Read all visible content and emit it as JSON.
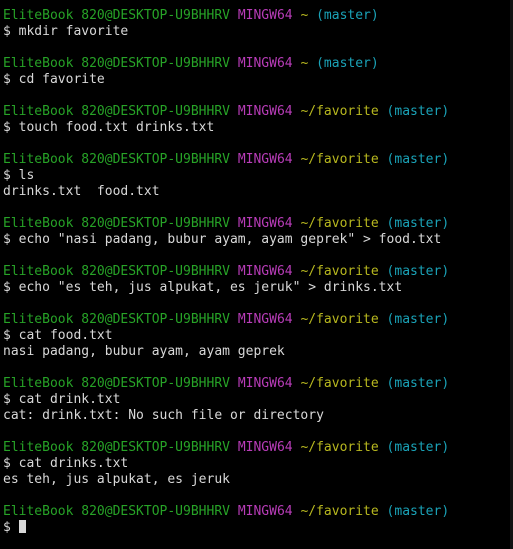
{
  "prompt": {
    "user_host": "EliteBook 820@DESKTOP-U9BHHRV",
    "system": "MINGW64",
    "dollar": "$ "
  },
  "blocks": [
    {
      "path": "~",
      "branch": "(master)",
      "command": "mkdir favorite",
      "output": []
    },
    {
      "path": "~",
      "branch": "(master)",
      "command": "cd favorite",
      "output": []
    },
    {
      "path": "~/favorite",
      "branch": "(master)",
      "command": "touch food.txt drinks.txt",
      "output": []
    },
    {
      "path": "~/favorite",
      "branch": "(master)",
      "command": "ls",
      "output": [
        "drinks.txt  food.txt"
      ]
    },
    {
      "path": "~/favorite",
      "branch": "(master)",
      "command": "echo \"nasi padang, bubur ayam, ayam geprek\" > food.txt",
      "output": []
    },
    {
      "path": "~/favorite",
      "branch": "(master)",
      "command": "echo \"es teh, jus alpukat, es jeruk\" > drinks.txt",
      "output": []
    },
    {
      "path": "~/favorite",
      "branch": "(master)",
      "command": "cat food.txt",
      "output": [
        "nasi padang, bubur ayam, ayam geprek"
      ]
    },
    {
      "path": "~/favorite",
      "branch": "(master)",
      "command": "cat drink.txt",
      "output": [
        "cat: drink.txt: No such file or directory"
      ]
    },
    {
      "path": "~/favorite",
      "branch": "(master)",
      "command": "cat drinks.txt",
      "output": [
        "es teh, jus alpukat, es jeruk"
      ]
    },
    {
      "path": "~/favorite",
      "branch": "(master)",
      "command": "",
      "output": []
    }
  ],
  "colors": {
    "background": "#000000",
    "user_host": "#27a327",
    "system": "#b83cb8",
    "path": "#b8b81f",
    "branch": "#1aa3b8",
    "text": "#d8d8d8"
  }
}
